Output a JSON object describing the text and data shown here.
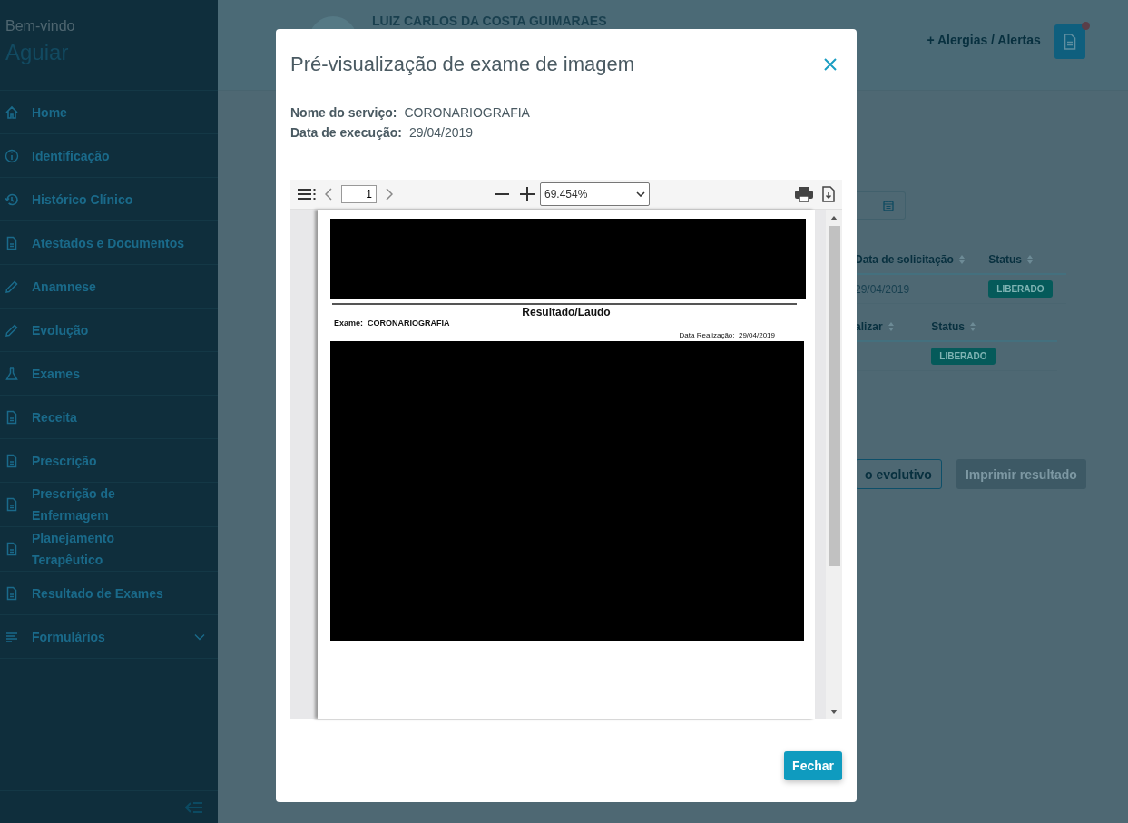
{
  "sidebar": {
    "greeting": "Bem-vindo",
    "user": "Aguiar",
    "items": [
      {
        "label": "Home",
        "kind": "home",
        "expandable": false
      },
      {
        "label": "Identificação",
        "kind": "info",
        "expandable": false
      },
      {
        "label": "Histórico Clínico",
        "kind": "history",
        "expandable": false
      },
      {
        "label": "Atestados e Documentos",
        "kind": "document",
        "expandable": false
      },
      {
        "label": "Anamnese",
        "kind": "pencil",
        "expandable": false
      },
      {
        "label": "Evolução",
        "kind": "pencil",
        "expandable": false
      },
      {
        "label": "Exames",
        "kind": "flask",
        "expandable": false
      },
      {
        "label": "Receita",
        "kind": "document",
        "expandable": false
      },
      {
        "label": "Prescrição",
        "kind": "document",
        "expandable": false
      },
      {
        "label": "Prescrição de Enfermagem",
        "kind": "document",
        "expandable": false
      },
      {
        "label": "Planejamento Terapêutico",
        "kind": "document",
        "expandable": false
      },
      {
        "label": "Resultado de Exames",
        "kind": "document",
        "expandable": false
      },
      {
        "label": "Formulários",
        "kind": "list",
        "expandable": true
      }
    ]
  },
  "header": {
    "patient_name": "LUIZ CARLOS DA COSTA GUIMARAES",
    "alerts_link": "+ Alergias / Alertas",
    "document_button": {
      "has_notification": true
    }
  },
  "tables": [
    {
      "columns": [
        "Data de solicitação",
        "Status"
      ],
      "rows": [
        {
          "cells": [
            "29/04/2019",
            "LIBERADO"
          ]
        }
      ]
    },
    {
      "columns": [
        "alizar",
        "Status"
      ],
      "rows": [
        {
          "cells": [
            null,
            "LIBERADO"
          ]
        }
      ]
    }
  ],
  "actions": [
    {
      "label": "o evolutivo",
      "disabled": false
    },
    {
      "label": "Imprimir resultado",
      "disabled": true
    }
  ],
  "modal": {
    "title": "Pré-visualização de exame de imagem",
    "fields": [
      {
        "label": "Nome do serviço:",
        "value": "CORONARIOGRAFIA"
      },
      {
        "label": "Data de execução:",
        "value": "29/04/2019"
      }
    ],
    "viewer": {
      "page": "1",
      "zoom": "69.454%",
      "document": {
        "heading": "Resultado/Laudo",
        "exam_label": "Exame:",
        "exam_value": "CORONARIOGRAFIA",
        "date_label": "Data Realização:",
        "date_value": "29/04/2019"
      }
    },
    "close_button": "Fechar"
  }
}
